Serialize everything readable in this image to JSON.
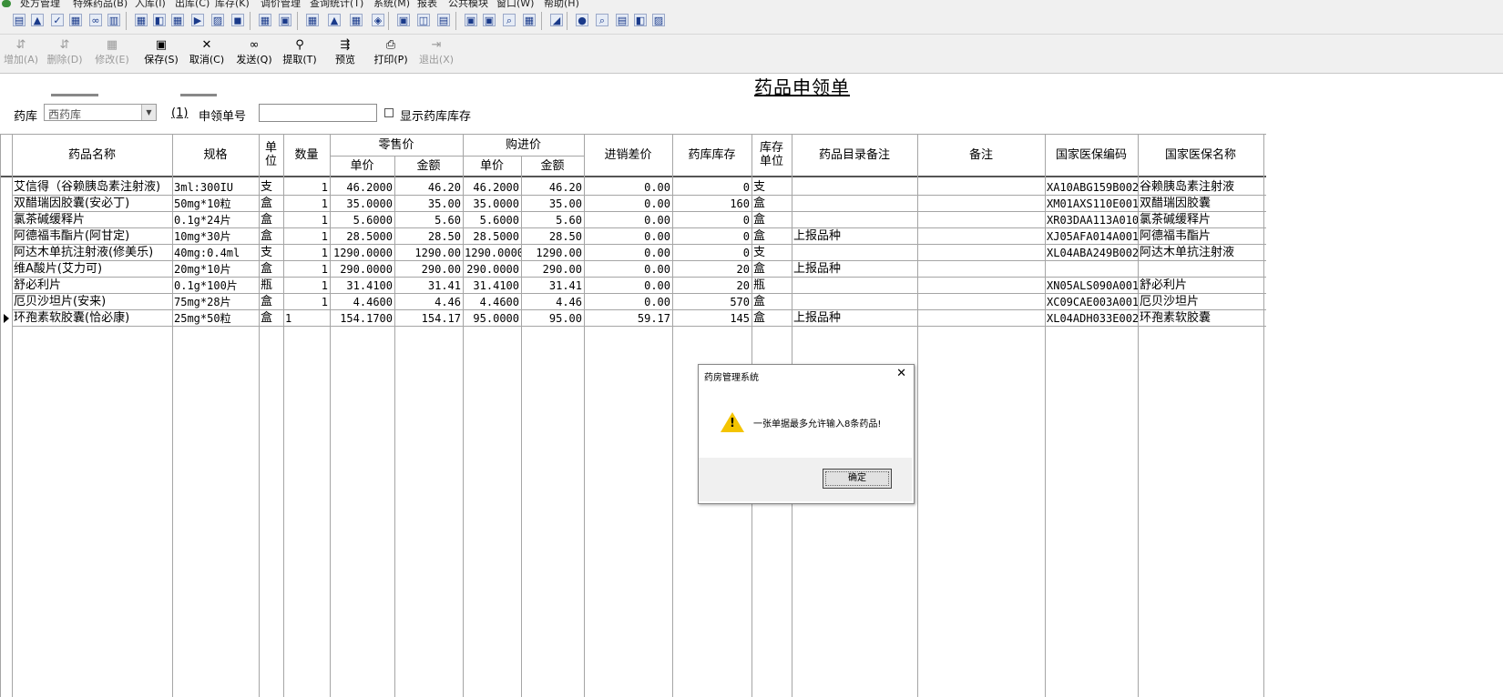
{
  "menu": [
    "处方管理",
    "特殊药品(B)",
    "入库(I)",
    "出库(C)",
    "库存(K)",
    "调价管理",
    "查询统计(T)",
    "系统(M)",
    "报表",
    "公共模块",
    "窗口(W)",
    "帮助(H)"
  ],
  "toolbar": {
    "add": "增加(A)",
    "delete": "删除(D)",
    "modify": "修改(E)",
    "save": "保存(S)",
    "cancel": "取消(C)",
    "send": "发送(Q)",
    "fetch": "提取(T)",
    "preview": "预览",
    "print": "打印(P)",
    "exit": "退出(X)"
  },
  "form": {
    "title": "药品申领单",
    "pharmacy_label": "药库",
    "pharmacy_value": "西药库",
    "pharmacy_hint": "(1)",
    "order_no_label": "申领单号",
    "order_no_value": "",
    "show_stock_label": "显示药库库存"
  },
  "table": {
    "headers": {
      "name": "药品名称",
      "spec": "规格",
      "unit": "单位",
      "qty": "数量",
      "retail": "零售价",
      "retail_price": "单价",
      "retail_amount": "金额",
      "purchase": "购进价",
      "purchase_price": "单价",
      "purchase_amount": "金额",
      "diff": "进销差价",
      "stock": "药库库存",
      "stock_unit": "库存单位",
      "catalog_note": "药品目录备注",
      "remark": "备注",
      "ins_code": "国家医保编码",
      "ins_name": "国家医保名称"
    },
    "rows": [
      {
        "name": "艾信得（谷赖胰岛素注射液)",
        "spec": "3ml:300IU",
        "unit": "支",
        "qty": "1",
        "rp": "46.2000",
        "ra": "46.20",
        "pp": "46.2000",
        "pa": "46.20",
        "diff": "0.00",
        "stock": "0",
        "su": "支",
        "note": "",
        "code": "XA10ABG159B002",
        "iname": "谷赖胰岛素注射液"
      },
      {
        "name": "双醋瑞因胶囊(安必丁)",
        "spec": "50mg*10粒",
        "unit": "盒",
        "qty": "1",
        "rp": "35.0000",
        "ra": "35.00",
        "pp": "35.0000",
        "pa": "35.00",
        "diff": "0.00",
        "stock": "160",
        "su": "盒",
        "note": "",
        "code": "XM01AXS110E001",
        "iname": "双醋瑞因胶囊"
      },
      {
        "name": "氯茶碱缓释片",
        "spec": "0.1g*24片",
        "unit": "盒",
        "qty": "1",
        "rp": "5.6000",
        "ra": "5.60",
        "pp": "5.6000",
        "pa": "5.60",
        "diff": "0.00",
        "stock": "0",
        "su": "盒",
        "note": "",
        "code": "XR03DAA113A010",
        "iname": "氯茶碱缓释片"
      },
      {
        "name": "阿德福韦酯片(阿甘定)",
        "spec": "10mg*30片",
        "unit": "盒",
        "qty": "1",
        "rp": "28.5000",
        "ra": "28.50",
        "pp": "28.5000",
        "pa": "28.50",
        "diff": "0.00",
        "stock": "0",
        "su": "盒",
        "note": "上报品种",
        "code": "XJ05AFA014A001",
        "iname": "阿德福韦酯片"
      },
      {
        "name": "阿达木单抗注射液(修美乐)",
        "spec": "40mg:0.4ml",
        "unit": "支",
        "qty": "1",
        "rp": "1290.0000",
        "ra": "1290.00",
        "pp": "1290.0000",
        "pa": "1290.00",
        "diff": "0.00",
        "stock": "0",
        "su": "支",
        "note": "",
        "code": "XL04ABA249B002",
        "iname": "阿达木单抗注射液"
      },
      {
        "name": "维A酸片(艾力可)",
        "spec": "20mg*10片",
        "unit": "盒",
        "qty": "1",
        "rp": "290.0000",
        "ra": "290.00",
        "pp": "290.0000",
        "pa": "290.00",
        "diff": "0.00",
        "stock": "20",
        "su": "盒",
        "note": "上报品种",
        "code": "",
        "iname": ""
      },
      {
        "name": "舒必利片",
        "spec": "0.1g*100片",
        "unit": "瓶",
        "qty": "1",
        "rp": "31.4100",
        "ra": "31.41",
        "pp": "31.4100",
        "pa": "31.41",
        "diff": "0.00",
        "stock": "20",
        "su": "瓶",
        "note": "",
        "code": "XN05ALS090A001",
        "iname": "舒必利片"
      },
      {
        "name": "厄贝沙坦片(安来)",
        "spec": "75mg*28片",
        "unit": "盒",
        "qty": "1",
        "rp": "4.4600",
        "ra": "4.46",
        "pp": "4.4600",
        "pa": "4.46",
        "diff": "0.00",
        "stock": "570",
        "su": "盒",
        "note": "",
        "code": "XC09CAE003A001",
        "iname": "厄贝沙坦片"
      },
      {
        "name": "环孢素软胶囊(恰必康)",
        "spec": "25mg*50粒",
        "unit": "盒",
        "qty": "1",
        "rp": "154.1700",
        "ra": "154.17",
        "pp": "95.0000",
        "pa": "95.00",
        "diff": "59.17",
        "stock": "145",
        "su": "盒",
        "note": "上报品种",
        "code": "XL04ADH033E002",
        "iname": "环孢素软胶囊"
      }
    ]
  },
  "dialog": {
    "title": "药房管理系统",
    "message": "一张单据最多允许输入8条药品!",
    "ok": "确定"
  },
  "colors": {
    "chrome": "#f0f0f0",
    "grid_line": "#a5a5a5",
    "warning": "#f4c400"
  }
}
